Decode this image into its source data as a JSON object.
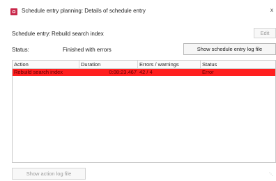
{
  "window": {
    "title": "Schedule entry planning: Details of schedule entry",
    "close_glyph": "x",
    "icon": "app-icon"
  },
  "details": {
    "schedule_entry_label": "Schedule entry:",
    "schedule_entry_value": "Rebuild search index",
    "status_label": "Status:",
    "status_value": "Finished with errors",
    "edit_button": "Edit",
    "log_button": "Show schedule entry log file"
  },
  "grid": {
    "columns": [
      "Action",
      "Duration",
      "Errors / warnings",
      "Status"
    ],
    "rows": [
      {
        "action": "Rebuild search index",
        "duration": "0:08:23.467",
        "errors": "42 / 4",
        "status": "Error",
        "highlight_color": "#ff1f1f"
      }
    ]
  },
  "footer": {
    "action_log_button": "Show action log file"
  }
}
